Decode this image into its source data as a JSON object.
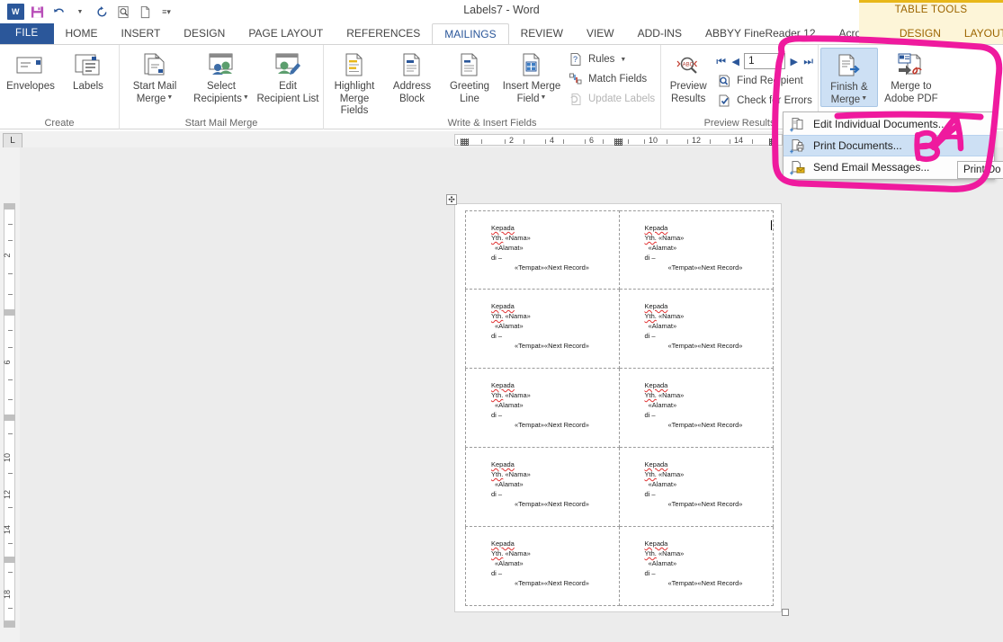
{
  "titlebar": {
    "document_title": "Labels7 - Word",
    "quick_access": [
      {
        "name": "word-logo",
        "label": "W"
      },
      {
        "name": "save-icon",
        "label": "ὋE"
      },
      {
        "name": "undo-icon",
        "label": "↶"
      },
      {
        "name": "redo-icon",
        "label": "↻"
      },
      {
        "name": "print-preview-icon",
        "label": "⌕"
      },
      {
        "name": "new-doc-icon",
        "label": "὜B"
      },
      {
        "name": "customize-qat-icon",
        "label": "⌄"
      }
    ],
    "contextual_group": "TABLE TOOLS"
  },
  "tabs": [
    {
      "label": "FILE",
      "kind": "file"
    },
    {
      "label": "HOME",
      "kind": "normal"
    },
    {
      "label": "INSERT",
      "kind": "normal"
    },
    {
      "label": "DESIGN",
      "kind": "normal"
    },
    {
      "label": "PAGE LAYOUT",
      "kind": "normal"
    },
    {
      "label": "REFERENCES",
      "kind": "normal"
    },
    {
      "label": "MAILINGS",
      "kind": "active"
    },
    {
      "label": "REVIEW",
      "kind": "normal"
    },
    {
      "label": "VIEW",
      "kind": "normal"
    },
    {
      "label": "ADD-INS",
      "kind": "normal"
    },
    {
      "label": "ABBYY FineReader 12",
      "kind": "normal"
    },
    {
      "label": "Acrobat",
      "kind": "normal"
    },
    {
      "label": "DESIGN",
      "kind": "ctx"
    },
    {
      "label": "LAYOUT",
      "kind": "ctx"
    }
  ],
  "ribbon": {
    "groups": [
      {
        "name": "create",
        "label": "Create",
        "buttons": [
          {
            "label_line1": "Envelopes",
            "label_line2": "",
            "icon": "envelope-icon"
          },
          {
            "label_line1": "Labels",
            "label_line2": "",
            "icon": "labels-icon"
          }
        ]
      },
      {
        "name": "start-mail-merge",
        "label": "Start Mail Merge",
        "buttons": [
          {
            "label_line1": "Start Mail",
            "label_line2": "Merge",
            "icon": "start-mail-merge-icon",
            "dropdown": true
          },
          {
            "label_line1": "Select",
            "label_line2": "Recipients",
            "icon": "select-recipients-icon",
            "dropdown": true
          },
          {
            "label_line1": "Edit",
            "label_line2": "Recipient List",
            "icon": "edit-recipient-list-icon",
            "dropdown": false
          }
        ]
      },
      {
        "name": "write-insert-fields",
        "label": "Write & Insert Fields",
        "buttons": [
          {
            "label_line1": "Highlight",
            "label_line2": "Merge Fields",
            "icon": "highlight-merge-fields-icon",
            "dropdown": false
          },
          {
            "label_line1": "Address",
            "label_line2": "Block",
            "icon": "address-block-icon",
            "dropdown": false
          },
          {
            "label_line1": "Greeting",
            "label_line2": "Line",
            "icon": "greeting-line-icon",
            "dropdown": false
          },
          {
            "label_line1": "Insert Merge",
            "label_line2": "Field",
            "icon": "insert-merge-field-icon",
            "dropdown": true
          }
        ],
        "small_buttons": [
          {
            "label": "Rules",
            "icon": "rules-icon",
            "dropdown": true,
            "disabled": false
          },
          {
            "label": "Match Fields",
            "icon": "match-fields-icon",
            "dropdown": false,
            "disabled": false
          },
          {
            "label": "Update Labels",
            "icon": "update-labels-icon",
            "dropdown": false,
            "disabled": true
          }
        ]
      },
      {
        "name": "preview-results",
        "label": "Preview Results",
        "buttons": [
          {
            "label_line1": "Preview",
            "label_line2": "Results",
            "icon": "preview-results-icon",
            "dropdown": false
          }
        ],
        "record_nav": {
          "first_label": "⏮",
          "prev_label": "◀",
          "record_value": "1",
          "next_label": "▶",
          "last_label": "⏭"
        },
        "small_buttons": [
          {
            "label": "Find Recipient",
            "icon": "find-recipient-icon",
            "disabled": false
          },
          {
            "label": "Check for Errors",
            "icon": "check-for-errors-icon",
            "disabled": false
          }
        ]
      },
      {
        "name": "finish",
        "label": "",
        "buttons": [
          {
            "label_line1": "Finish &",
            "label_line2": "Merge",
            "icon": "finish-and-merge-icon",
            "dropdown": true,
            "selected": true
          },
          {
            "label_line1": "Merge to",
            "label_line2": "Adobe PDF",
            "icon": "merge-to-adobe-pdf-icon",
            "dropdown": false
          }
        ]
      }
    ]
  },
  "finish_merge_menu": {
    "items": [
      {
        "label": "Edit Individual Documents...",
        "icon": "edit-individual-documents-icon",
        "highlighted": false
      },
      {
        "label": "Print Documents...",
        "icon": "print-documents-icon",
        "highlighted": true
      },
      {
        "label": "Send Email Messages...",
        "icon": "send-email-messages-icon",
        "highlighted": false
      }
    ]
  },
  "tooltip": {
    "text": "Print Do"
  },
  "rulers": {
    "horizontal": {
      "numbers": [
        "2",
        "4",
        "6",
        "10",
        "12",
        "14"
      ]
    },
    "vertical": {
      "numbers": [
        "2",
        "6",
        "10",
        "12",
        "14",
        "18"
      ]
    },
    "tab_stop_marker": "L"
  },
  "document": {
    "label_text": {
      "line1": "Kepada",
      "line2_prefix": "Yth.",
      "line2_field": "«Nama»",
      "line3_field": "«Alamat»",
      "line4": "di –",
      "line5_field": "«Tempat»«Next Record»"
    },
    "label_count": 10,
    "columns": 2,
    "rows": 5
  },
  "annotations": {
    "ink_color": "#ef1a9e",
    "marks": [
      {
        "name": "circle-around-finish-merge",
        "type": "ellipse"
      },
      {
        "name": "letter-a",
        "type": "text",
        "label": "A"
      },
      {
        "name": "letter-b",
        "type": "text",
        "label": "B"
      }
    ]
  }
}
